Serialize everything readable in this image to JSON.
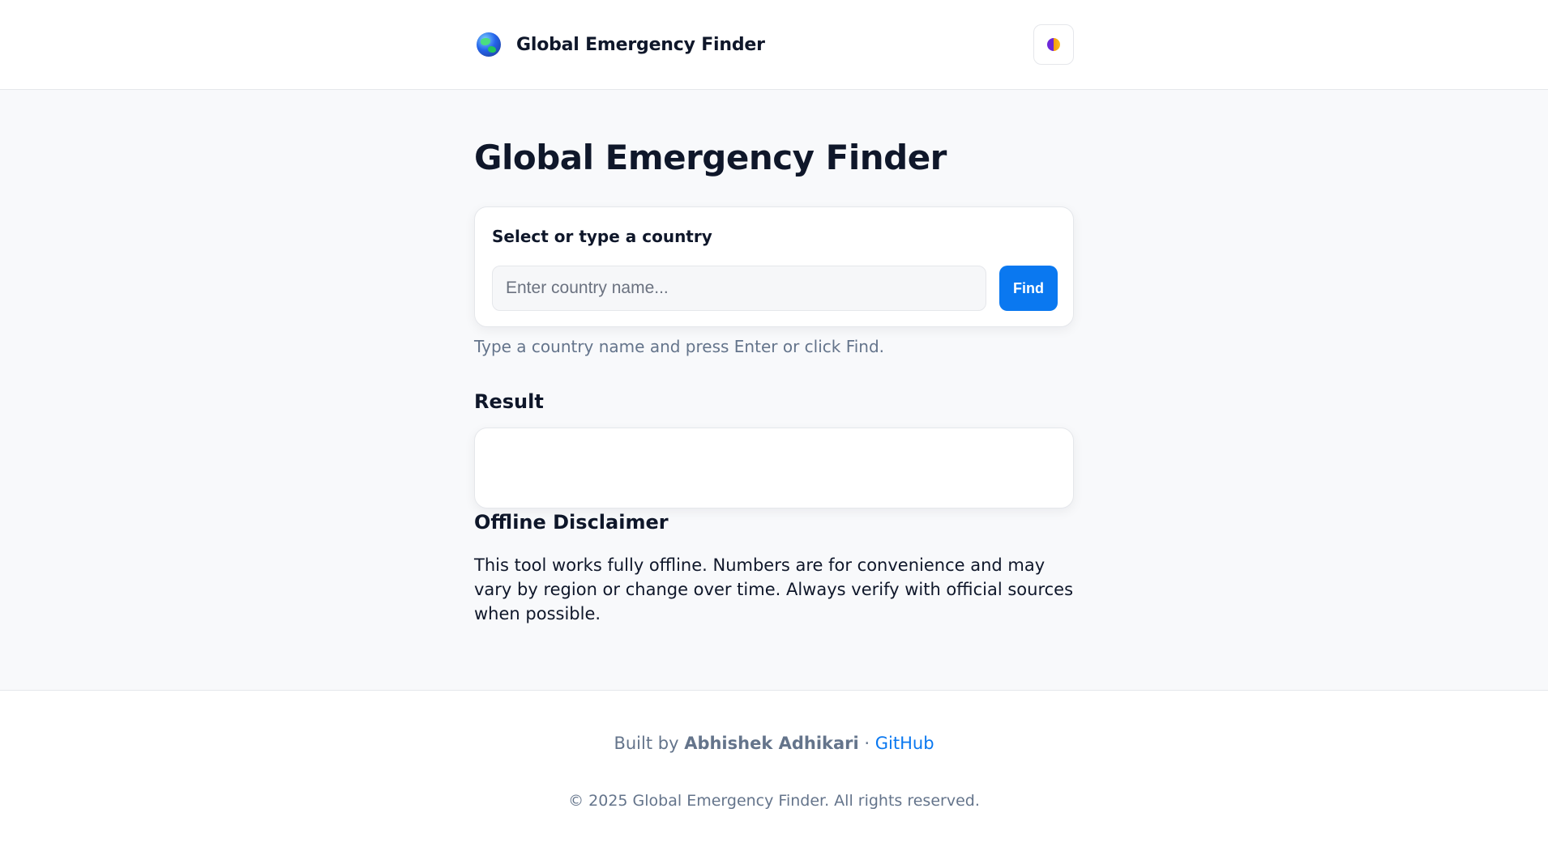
{
  "header": {
    "brand_title": "Global Emergency Finder",
    "logo_icon": "globe-icon",
    "theme_toggle_icon": "half-moon-icon"
  },
  "main": {
    "page_title": "Global Emergency Finder",
    "search": {
      "label": "Select or type a country",
      "placeholder": "Enter country name...",
      "value": "",
      "button_label": "Find"
    },
    "hint": "Type a country name and press Enter or click Find.",
    "result_heading": "Result",
    "result_content": "",
    "disclaimer_heading": "Offline Disclaimer",
    "disclaimer_text": "This tool works fully offline. Numbers are for convenience and may vary by region or change over time. Always verify with official sources when possible."
  },
  "footer": {
    "built_by_prefix": "Built by ",
    "author": "Abhishek Adhikari",
    "separator": " · ",
    "github_label": "GitHub",
    "copyright": "© 2025 Global Emergency Finder. All rights reserved."
  },
  "colors": {
    "accent": "#0a78f0",
    "text_primary": "#0f172a",
    "text_muted": "#64748b",
    "page_background": "#f8f9fb"
  }
}
